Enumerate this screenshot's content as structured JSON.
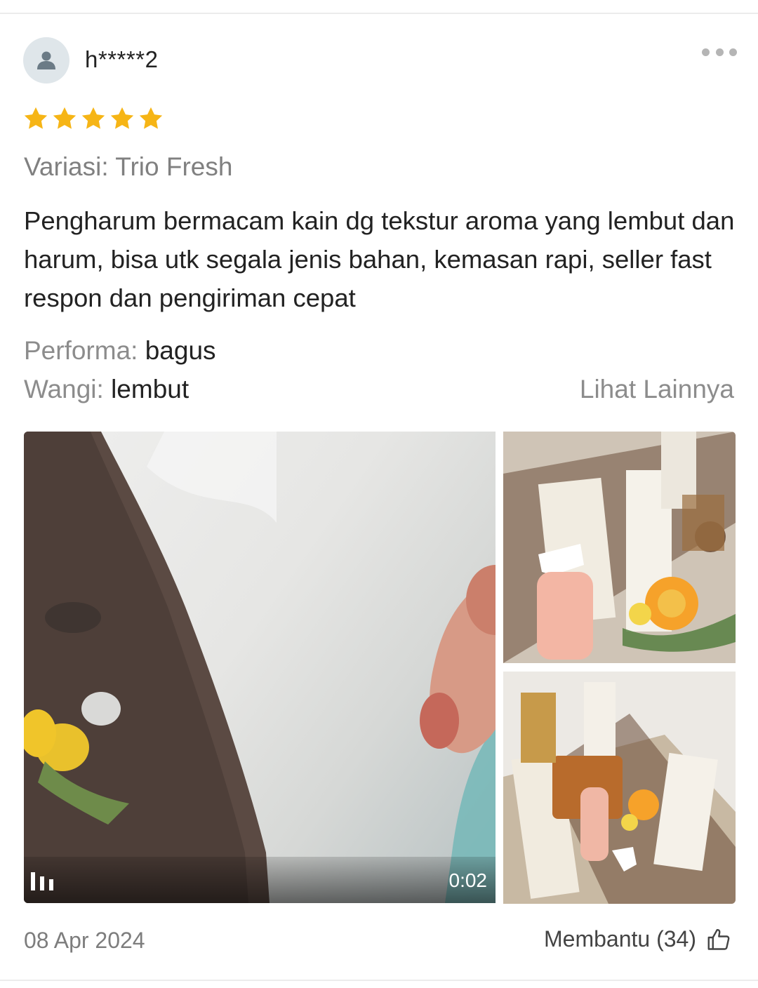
{
  "review": {
    "username": "h*****2",
    "rating": 5,
    "variant": "Variasi: Trio Fresh",
    "text": "Pengharum bermacam kain dg tekstur aroma yang lembut dan harum, bisa utk segala jenis bahan, kemasan rapi, seller fast respon dan pengiriman cepat",
    "attributes": [
      {
        "key": "Performa:",
        "value": "bagus"
      },
      {
        "key": "Wangi:",
        "value": "lembut"
      }
    ],
    "see_more": "Lihat Lainnya",
    "media": {
      "video_duration": "0:02"
    },
    "date": "08 Apr 2024",
    "helpful_label": "Membantu (34)"
  },
  "colors": {
    "star": "#f6b516",
    "muted_text": "#808080",
    "text": "#222222",
    "avatar_bg": "#dfe6ea"
  },
  "icons": {
    "avatar": "user-silhouette-icon",
    "more": "more-dots-icon",
    "star": "star-icon",
    "video": "video-indicator-icon",
    "helpful": "thumbs-up-icon"
  }
}
